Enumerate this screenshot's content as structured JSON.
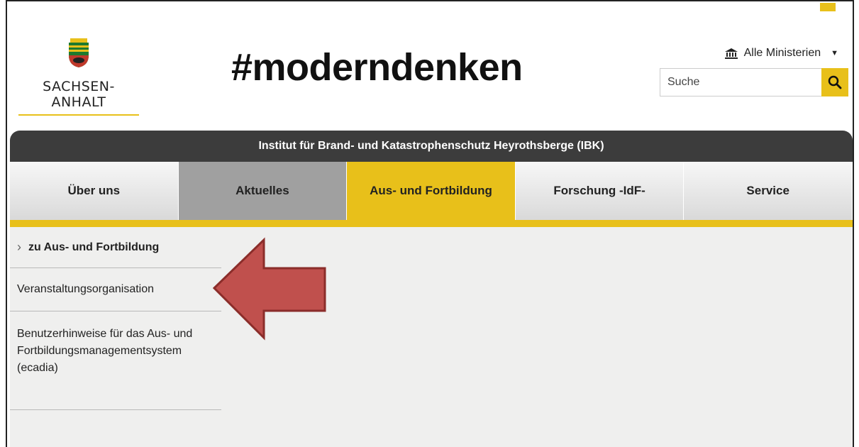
{
  "brand": {
    "state_name": "SACHSEN-ANHALT",
    "claim": "#moderndenken"
  },
  "header": {
    "ministries_label": "Alle Ministerien",
    "search": {
      "placeholder": "Suche",
      "value": ""
    }
  },
  "nav": {
    "site_title": "Institut für Brand- und Katastrophenschutz Heyrothsberge (IBK)",
    "items": [
      {
        "label": "Über uns"
      },
      {
        "label": "Aktuelles"
      },
      {
        "label": "Aus- und Fortbildung",
        "active": true
      },
      {
        "label": "Forschung -IdF-"
      },
      {
        "label": "Service"
      }
    ]
  },
  "sidebar": {
    "items": [
      {
        "label": "zu Aus- und Fortbildung"
      },
      {
        "label": "Veranstaltungsorganisation"
      },
      {
        "label": "Benutzerhinweise für das Aus- und Fortbildungsmanagementsystem (ecadia)"
      }
    ]
  },
  "colors": {
    "accent": "#e8c01a",
    "nav_dark": "#3c3c3c",
    "annotation_arrow": "#c0504d"
  },
  "icons": [
    "coat-of-arms-icon",
    "ministry-building-icon",
    "chevron-down-icon",
    "search-icon",
    "chevron-right-icon",
    "annotation-arrow-icon"
  ]
}
